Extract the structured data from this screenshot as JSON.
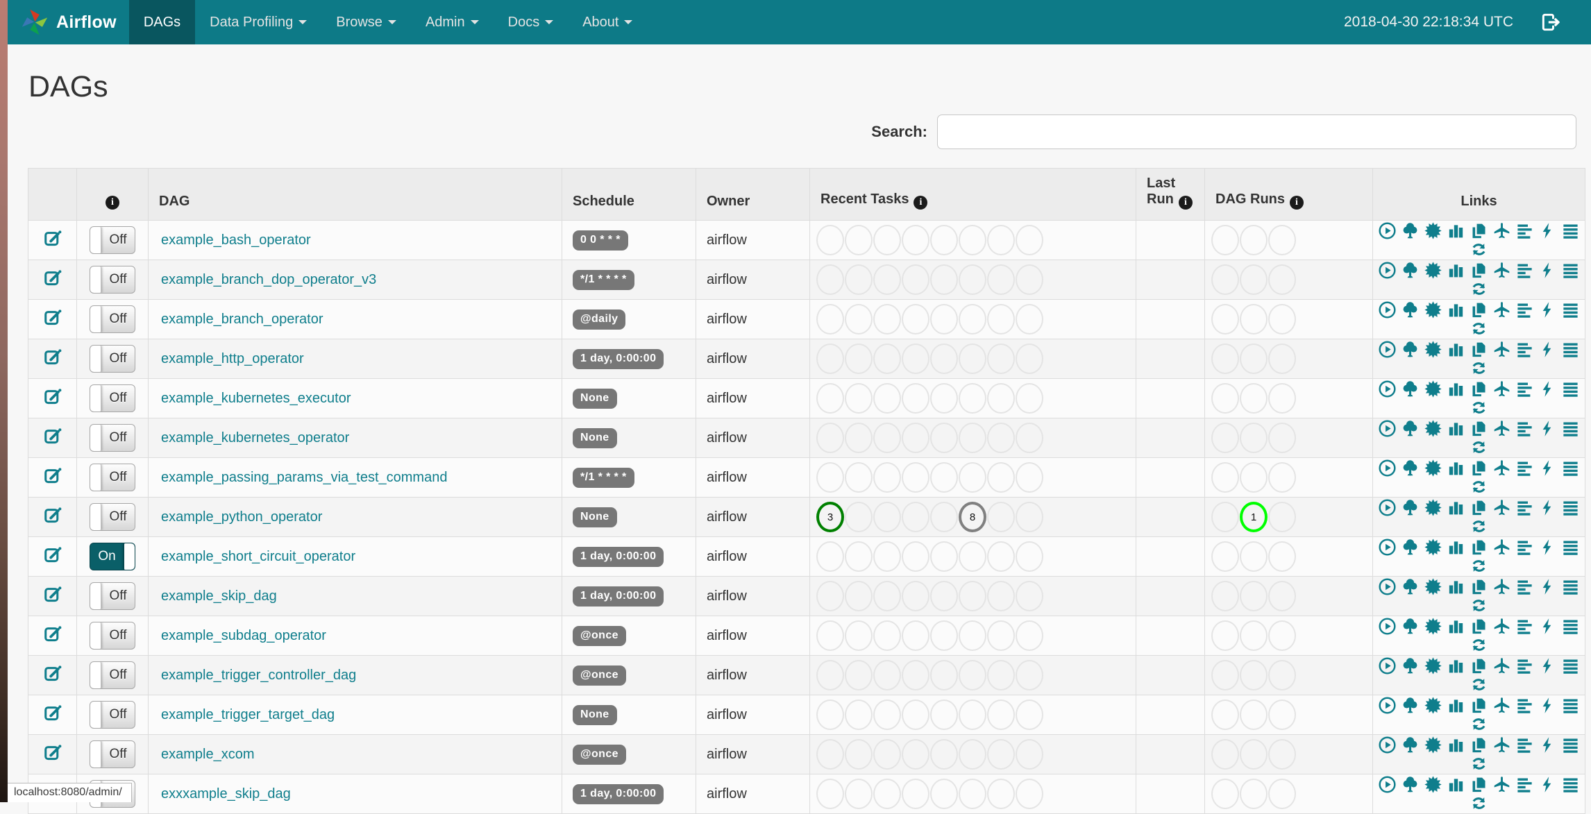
{
  "navbar": {
    "brand": "Airflow",
    "menu": [
      {
        "label": "DAGs",
        "active": true,
        "caret": false
      },
      {
        "label": "Data Profiling",
        "active": false,
        "caret": true
      },
      {
        "label": "Browse",
        "active": false,
        "caret": true
      },
      {
        "label": "Admin",
        "active": false,
        "caret": true
      },
      {
        "label": "Docs",
        "active": false,
        "caret": true
      },
      {
        "label": "About",
        "active": false,
        "caret": true
      }
    ],
    "clock": "2018-04-30 22:18:34 UTC"
  },
  "page": {
    "title": "DAGs"
  },
  "search": {
    "label": "Search:",
    "value": "",
    "placeholder": ""
  },
  "table": {
    "info_glyph": "i",
    "headers": {
      "dag": "DAG",
      "schedule": "Schedule",
      "owner": "Owner",
      "recent_tasks": "Recent Tasks",
      "last_run": "Last Run",
      "dag_runs": "DAG Runs",
      "links": "Links"
    },
    "recent_task_slots": 8,
    "dag_run_slots": 3,
    "link_icons": [
      {
        "name": "play-circle-icon",
        "title": "Trigger Dag"
      },
      {
        "name": "tree-icon",
        "title": "Tree View"
      },
      {
        "name": "sunburst-icon",
        "title": "Graph View"
      },
      {
        "name": "bar-chart-icon",
        "title": "Tasks Duration"
      },
      {
        "name": "duplicate-icon",
        "title": "Task Tries"
      },
      {
        "name": "plane-icon",
        "title": "Landing Times"
      },
      {
        "name": "align-left-icon",
        "title": "Gantt View"
      },
      {
        "name": "bolt-icon",
        "title": "Code View"
      },
      {
        "name": "align-justify-icon",
        "title": "DAG Details"
      },
      {
        "name": "refresh-icon",
        "title": "Refresh"
      }
    ],
    "rows": [
      {
        "dag_id": "example_bash_operator",
        "toggle": "Off",
        "schedule": "0 0 * * *",
        "owner": "airflow",
        "recent_tasks": [],
        "dag_runs": []
      },
      {
        "dag_id": "example_branch_dop_operator_v3",
        "toggle": "Off",
        "schedule": "*/1 * * * *",
        "owner": "airflow",
        "recent_tasks": [],
        "dag_runs": []
      },
      {
        "dag_id": "example_branch_operator",
        "toggle": "Off",
        "schedule": "@daily",
        "owner": "airflow",
        "recent_tasks": [],
        "dag_runs": []
      },
      {
        "dag_id": "example_http_operator",
        "toggle": "Off",
        "schedule": "1 day, 0:00:00",
        "owner": "airflow",
        "recent_tasks": [],
        "dag_runs": []
      },
      {
        "dag_id": "example_kubernetes_executor",
        "toggle": "Off",
        "schedule": "None",
        "owner": "airflow",
        "recent_tasks": [],
        "dag_runs": []
      },
      {
        "dag_id": "example_kubernetes_operator",
        "toggle": "Off",
        "schedule": "None",
        "owner": "airflow",
        "recent_tasks": [],
        "dag_runs": []
      },
      {
        "dag_id": "example_passing_params_via_test_command",
        "toggle": "Off",
        "schedule": "*/1 * * * *",
        "owner": "airflow",
        "recent_tasks": [],
        "dag_runs": []
      },
      {
        "dag_id": "example_python_operator",
        "toggle": "Off",
        "schedule": "None",
        "owner": "airflow",
        "recent_tasks": [
          {
            "slot": 0,
            "count": "3",
            "state": "success"
          },
          {
            "slot": 5,
            "count": "8",
            "state": "queued"
          }
        ],
        "dag_runs": [
          {
            "slot": 1,
            "count": "1",
            "state": "running"
          }
        ]
      },
      {
        "dag_id": "example_short_circuit_operator",
        "toggle": "On",
        "schedule": "1 day, 0:00:00",
        "owner": "airflow",
        "recent_tasks": [],
        "dag_runs": []
      },
      {
        "dag_id": "example_skip_dag",
        "toggle": "Off",
        "schedule": "1 day, 0:00:00",
        "owner": "airflow",
        "recent_tasks": [],
        "dag_runs": []
      },
      {
        "dag_id": "example_subdag_operator",
        "toggle": "Off",
        "schedule": "@once",
        "owner": "airflow",
        "recent_tasks": [],
        "dag_runs": []
      },
      {
        "dag_id": "example_trigger_controller_dag",
        "toggle": "Off",
        "schedule": "@once",
        "owner": "airflow",
        "recent_tasks": [],
        "dag_runs": []
      },
      {
        "dag_id": "example_trigger_target_dag",
        "toggle": "Off",
        "schedule": "None",
        "owner": "airflow",
        "recent_tasks": [],
        "dag_runs": []
      },
      {
        "dag_id": "example_xcom",
        "toggle": "Off",
        "schedule": "@once",
        "owner": "airflow",
        "recent_tasks": [],
        "dag_runs": []
      },
      {
        "dag_id": "exxxample_skip_dag",
        "toggle": "Off",
        "schedule": "1 day, 0:00:00",
        "owner": "airflow",
        "recent_tasks": [],
        "dag_runs": []
      }
    ]
  },
  "state_colors": {
    "success": "#008000",
    "running": "#00ff00",
    "queued": "#808080"
  },
  "statusbar": {
    "text": "localhost:8080/admin/"
  },
  "colors": {
    "navbar": "#0d7a87",
    "navbar_active": "#09565f",
    "accent_teal": "#0f7e8c",
    "badge_grey": "#777777"
  }
}
